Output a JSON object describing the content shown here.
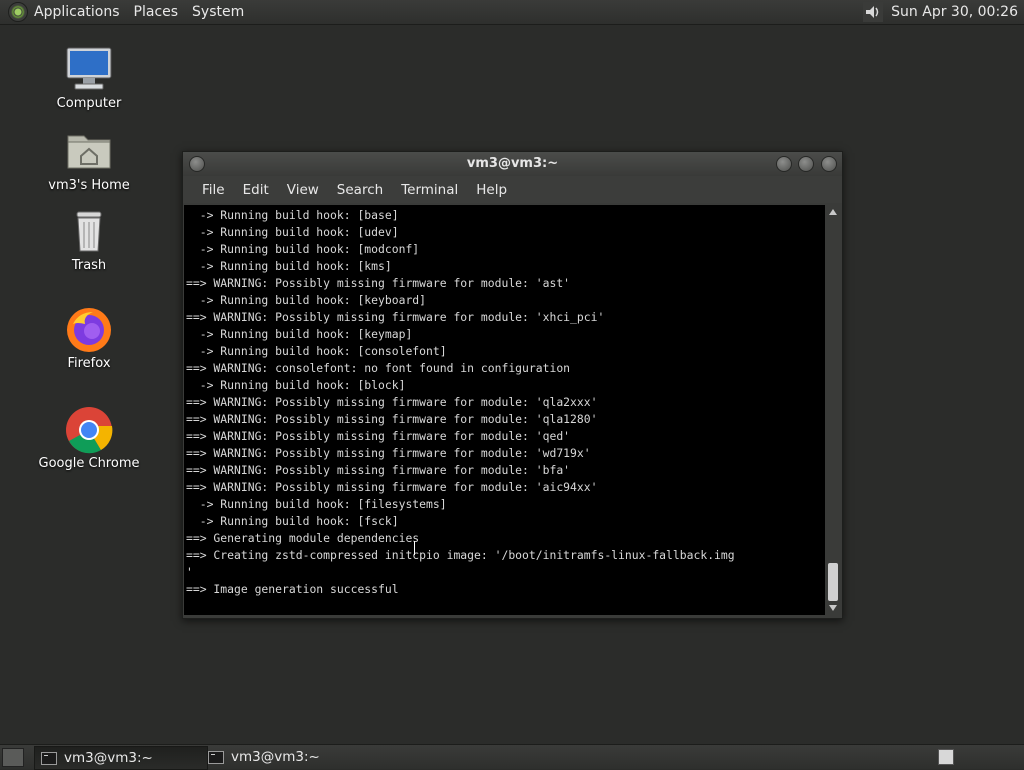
{
  "top_panel": {
    "menus": [
      "Applications",
      "Places",
      "System"
    ],
    "clock": "Sun Apr 30, 00:26"
  },
  "desktop": {
    "icons": [
      {
        "label": "Computer"
      },
      {
        "label": "vm3's Home"
      },
      {
        "label": "Trash"
      },
      {
        "label": "Firefox"
      },
      {
        "label": "Google Chrome"
      }
    ]
  },
  "terminal": {
    "title": "vm3@vm3:~",
    "menu": [
      "File",
      "Edit",
      "View",
      "Search",
      "Terminal",
      "Help"
    ],
    "lines": [
      "  -> Running build hook: [base]",
      "  -> Running build hook: [udev]",
      "  -> Running build hook: [modconf]",
      "  -> Running build hook: [kms]",
      "==> WARNING: Possibly missing firmware for module: 'ast'",
      "  -> Running build hook: [keyboard]",
      "==> WARNING: Possibly missing firmware for module: 'xhci_pci'",
      "  -> Running build hook: [keymap]",
      "  -> Running build hook: [consolefont]",
      "==> WARNING: consolefont: no font found in configuration",
      "  -> Running build hook: [block]",
      "==> WARNING: Possibly missing firmware for module: 'qla2xxx'",
      "==> WARNING: Possibly missing firmware for module: 'qla1280'",
      "==> WARNING: Possibly missing firmware for module: 'qed'",
      "==> WARNING: Possibly missing firmware for module: 'wd719x'",
      "==> WARNING: Possibly missing firmware for module: 'bfa'",
      "==> WARNING: Possibly missing firmware for module: 'aic94xx'",
      "  -> Running build hook: [filesystems]",
      "  -> Running build hook: [fsck]",
      "==> Generating module dependencies",
      "==> Creating zstd-compressed initcpio image: '/boot/initramfs-linux-fallback.img",
      "'",
      "==> Image generation successful"
    ]
  },
  "taskbar": {
    "tasks": [
      {
        "label": "vm3@vm3:~"
      },
      {
        "label": "vm3@vm3:~"
      }
    ]
  }
}
